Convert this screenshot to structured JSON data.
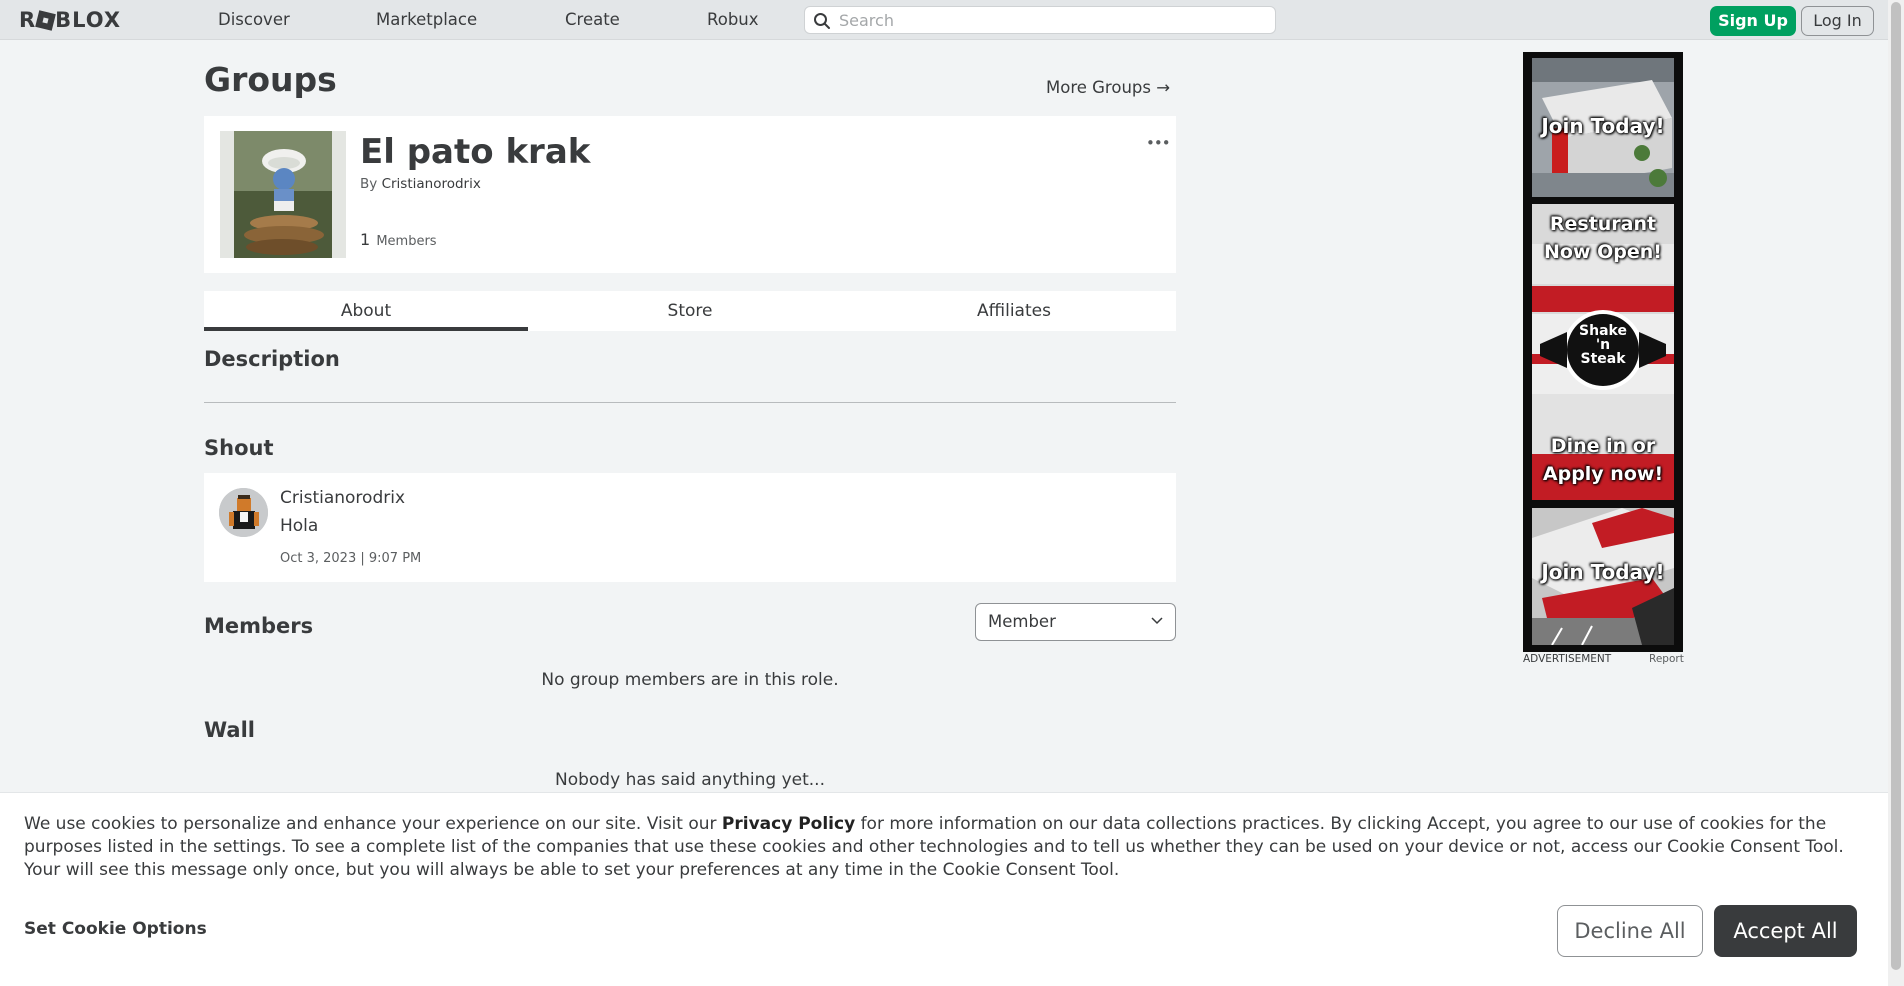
{
  "nav": {
    "logo": "ROBLOX",
    "logo_before": "R",
    "logo_after": "BLOX",
    "links": [
      "Discover",
      "Marketplace",
      "Create",
      "Robux"
    ],
    "search_placeholder": "Search",
    "signup": "Sign Up",
    "login": "Log In"
  },
  "page": {
    "title": "Groups",
    "more_groups": "More Groups →"
  },
  "group": {
    "name": "El pato krak",
    "by_prefix": "By",
    "owner": "Cristianorodrix",
    "member_count": "1",
    "member_label": "Members",
    "more": "•••"
  },
  "tabs": [
    "About",
    "Store",
    "Affiliates"
  ],
  "description": {
    "heading": "Description"
  },
  "shout": {
    "heading": "Shout",
    "user": "Cristianorodrix",
    "message": "Hola",
    "date": "Oct 3, 2023 | 9:07 PM"
  },
  "members": {
    "heading": "Members",
    "role": "Member",
    "empty": "No group members are in this role."
  },
  "wall": {
    "heading": "Wall",
    "empty": "Nobody has said anything yet..."
  },
  "ad": {
    "panel1": "Join Today!",
    "panel2_top": "Resturant Now Open!",
    "logo_line1": "Shake",
    "logo_line2": "'n",
    "logo_line3": "Steak",
    "panel2_bottom": "Dine in or Apply now!",
    "panel3": "Join Today!",
    "caption": "ADVERTISEMENT",
    "report": "Report"
  },
  "cookie": {
    "text_before": "We use cookies to personalize and enhance your experience on our site. Visit our ",
    "privacy_link": "Privacy Policy",
    "text_after": " for more information on our data collections practices. By clicking Accept, you agree to our use of cookies for the purposes listed in the settings. To see a complete list of the companies that use these cookies and other technologies and to tell us whether they can be used on your device or not, access our Cookie Consent Tool. Your will see this message only once, but you will always be able to set your preferences at any time in the Cookie Consent Tool.",
    "set_options": "Set Cookie Options",
    "decline": "Decline All",
    "accept": "Accept All"
  },
  "colors": {
    "signup_green": "#00a060",
    "text_dark": "#393b3d",
    "background": "#f2f4f5",
    "nav_bg": "#e3e6e8"
  }
}
